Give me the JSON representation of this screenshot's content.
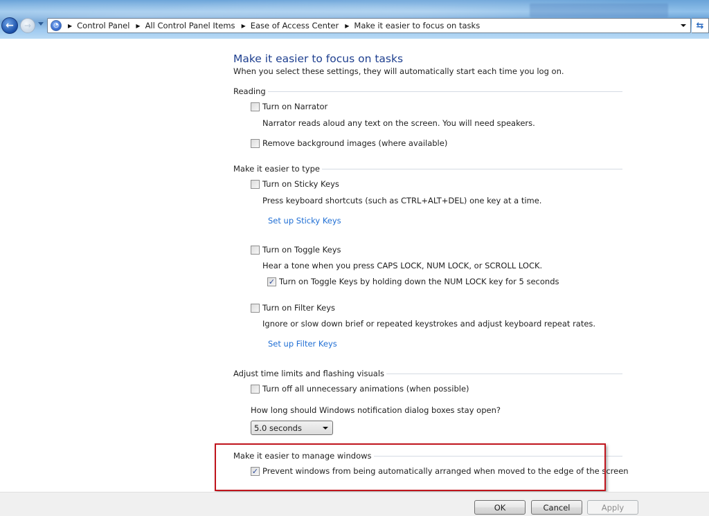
{
  "navigation": {
    "back_icon": "back-arrow-icon",
    "forward_icon": "forward-arrow-icon",
    "history_icon": "chevron-down-icon",
    "breadcrumbs": [
      {
        "label": "Control Panel"
      },
      {
        "label": "All Control Panel Items"
      },
      {
        "label": "Ease of Access Center"
      },
      {
        "label": "Make it easier to focus on tasks"
      }
    ],
    "root_icon": "control-panel-icon",
    "refresh_icon": "refresh-icon"
  },
  "page": {
    "title": "Make it easier to focus on tasks",
    "subtitle": "When you select these settings, they will automatically start each time you log on."
  },
  "sections": {
    "reading": {
      "heading": "Reading",
      "narrator": {
        "label": "Turn on Narrator",
        "checked": false,
        "description": "Narrator reads aloud any text on the screen. You will need speakers."
      },
      "background": {
        "label": "Remove background images (where available)",
        "checked": false
      }
    },
    "typing": {
      "heading": "Make it easier to type",
      "sticky": {
        "label": "Turn on Sticky Keys",
        "checked": false,
        "description": "Press keyboard shortcuts (such as CTRL+ALT+DEL) one key at a time.",
        "link": "Set up Sticky Keys"
      },
      "toggle": {
        "label": "Turn on Toggle Keys",
        "checked": false,
        "description": "Hear a tone when you press CAPS LOCK, NUM LOCK, or SCROLL LOCK.",
        "sub": {
          "label": "Turn on Toggle Keys by holding down the NUM LOCK key for 5 seconds",
          "checked": true
        }
      },
      "filter": {
        "label": "Turn on Filter Keys",
        "checked": false,
        "description": "Ignore or slow down brief or repeated keystrokes and adjust keyboard repeat rates.",
        "link": "Set up Filter Keys"
      }
    },
    "time": {
      "heading": "Adjust time limits and flashing visuals",
      "animations": {
        "label": "Turn off all unnecessary animations (when possible)",
        "checked": false
      },
      "notification_question": "How long should Windows notification dialog boxes stay open?",
      "notification_value": "5.0 seconds"
    },
    "windows": {
      "heading": "Make it easier to manage windows",
      "snap": {
        "label": "Prevent windows from being automatically arranged when moved to the edge of the screen",
        "checked": true
      }
    }
  },
  "buttons": {
    "ok": "OK",
    "cancel": "Cancel",
    "apply": "Apply"
  },
  "colors": {
    "title": "#1e3f8f",
    "link": "#1f6ed4",
    "highlight": "#c0141c"
  },
  "check_glyph": "✓"
}
